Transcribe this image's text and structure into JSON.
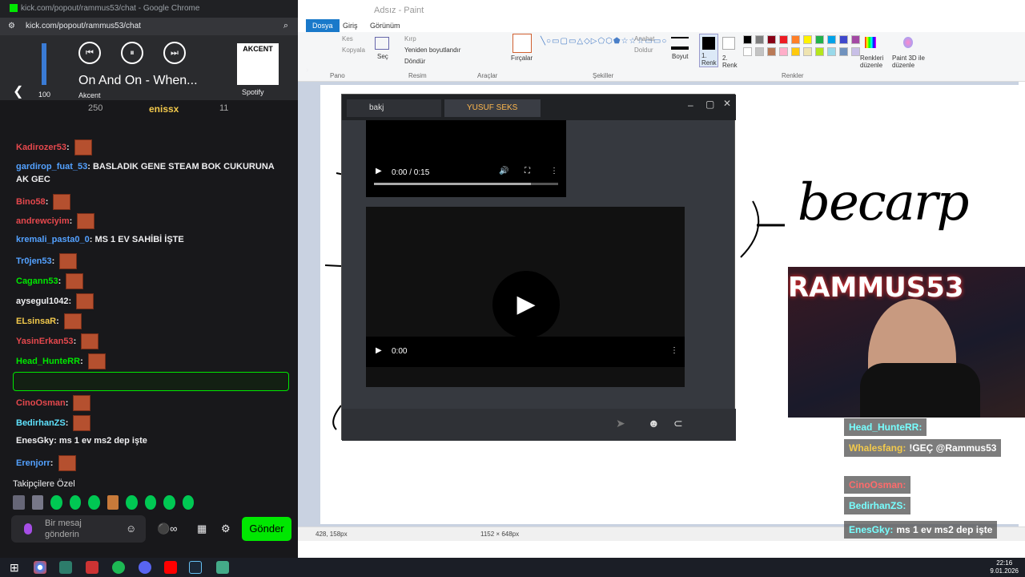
{
  "chrome": {
    "title": "kick.com/popout/rammus53/chat - Google Chrome",
    "url": "kick.com/popout/rammus53/chat"
  },
  "media": {
    "volume": "100",
    "track": "On And On - When...",
    "artist": "Akcent",
    "album_art_text": "AKCENT",
    "spotify": "Spotify"
  },
  "chat_header": {
    "count": "250",
    "user": "enissx",
    "count2": "11"
  },
  "messages": [
    {
      "user": "Kadirozer53",
      "text": "",
      "color": "#e5484d"
    },
    {
      "user": "gardirop_fuat_53",
      "text": "BASLADIK GENE STEAM BOK CUKURUNA AK GEC",
      "color": "#53a1ff"
    },
    {
      "user": "Bino58",
      "text": "",
      "color": "#e5484d"
    },
    {
      "user": "andrewciyim",
      "text": "",
      "color": "#e5484d"
    },
    {
      "user": "kremali_pasta0_0",
      "text": "MS 1 EV SAHİBİ İŞTE",
      "color": "#53a1ff"
    },
    {
      "user": "Tr0jen53",
      "text": "",
      "color": "#53a1ff"
    },
    {
      "user": "Cagann53",
      "text": "",
      "color": "#00e701"
    },
    {
      "user": "aysegul1042",
      "text": "",
      "color": "#efeff1"
    },
    {
      "user": "ELsinsaR",
      "text": "",
      "color": "#f2c94c"
    },
    {
      "user": "YasinErkan53",
      "text": "",
      "color": "#e5484d"
    },
    {
      "user": "Head_HunteRR",
      "text": "",
      "color": "#00e701"
    },
    {
      "user": "Whalesfang",
      "text": "!GEÇ @Rammus53",
      "color": "#f2c94c"
    },
    {
      "user": "CinoOsman",
      "text": "",
      "color": "#e5484d"
    },
    {
      "user": "BedirhanZS",
      "text": "",
      "color": "#5fe3ff"
    },
    {
      "user": "EnesGky",
      "text": "ms 1 ev ms2 dep işte",
      "color": "#efeff1"
    },
    {
      "user": "Erenjorr",
      "text": "",
      "color": "#53a1ff"
    }
  ],
  "followers_only": "Takipçilere Özel",
  "input_placeholder": "Bir mesaj gönderin",
  "send_label": "Gönder",
  "paint": {
    "title": "Adsız - Paint",
    "tabs": [
      "Dosya",
      "Giriş",
      "Görünüm"
    ],
    "ribbon": {
      "kes": "Kes",
      "kopyala": "Kopyala",
      "sec": "Seç",
      "kirp": "Kırp",
      "yeniden": "Yeniden boyutlandır",
      "dondur": "Döndür",
      "fircalar": "Fırçalar",
      "anahat": "Anahat",
      "doldur": "Doldur",
      "boyut": "Boyut",
      "renk1": "1. Renk",
      "renk2": "2. Renk",
      "renkleri_duzenle": "Renkleri düzenle",
      "paint3d": "Paint 3D ile düzenle"
    },
    "groups": [
      "Pano",
      "Resim",
      "Araçlar",
      "Şekiller",
      "Renkler"
    ],
    "handwriting": "becarp",
    "status_pos": "428, 158px",
    "status_size": "1152 × 648px"
  },
  "discord": {
    "tabs": [
      "bakj",
      "YUSUF SEKS"
    ],
    "video1_time": "0:00 / 0:15",
    "video3_time": "0:00"
  },
  "webcam": {
    "overlay": "RAMMUS53"
  },
  "cam_chat": [
    {
      "user": "Head_HunteRR:",
      "text": ""
    },
    {
      "user": "Whalesfang:",
      "text": "!GEÇ @Rammus53"
    },
    {
      "user": "CinoOsman:",
      "text": ""
    },
    {
      "user": "BedirhanZS:",
      "text": ""
    },
    {
      "user": "EnesGky:",
      "text": "ms 1 ev ms2 dep işte"
    }
  ],
  "taskbar": {
    "time": "22:16",
    "date": "9.01.2026"
  },
  "palette": [
    "#000000",
    "#7f7f7f",
    "#880015",
    "#ed1c24",
    "#ff7f27",
    "#fff200",
    "#22b14c",
    "#00a2e8",
    "#3f48cc",
    "#a349a4",
    "#ffffff",
    "#c3c3c3",
    "#b97a57",
    "#ffaec9",
    "#ffc90e",
    "#efe4b0",
    "#b5e61d",
    "#99d9ea",
    "#7092be",
    "#c8bfe7"
  ]
}
